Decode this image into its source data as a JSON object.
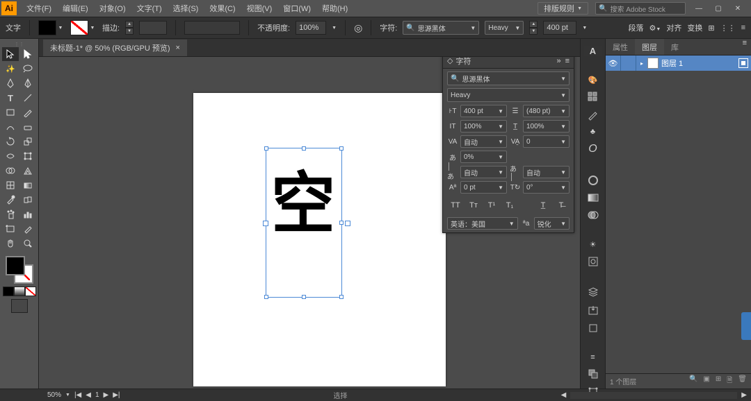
{
  "app_logo": "Ai",
  "menu": {
    "file": "文件(F)",
    "edit": "编辑(E)",
    "object": "对象(O)",
    "type": "文字(T)",
    "select": "选择(S)",
    "effect": "效果(C)",
    "view": "视图(V)",
    "window": "窗口(W)",
    "help": "帮助(H)"
  },
  "workspace": "排版规则",
  "stock_placeholder": "搜索 Adobe Stock",
  "control": {
    "mode_label": "文字",
    "stroke_label": "描边:",
    "stroke_val": "",
    "opacity_label": "不透明度:",
    "opacity_val": "100%",
    "char_label": "字符:",
    "font_family": "思源黑体",
    "font_style": "Heavy",
    "font_size": "400 pt",
    "right1": "段落",
    "right2": "对齐",
    "right3": "变换"
  },
  "tab": {
    "title": "未标题-1* @ 50% (RGB/GPU 预览)"
  },
  "glyph": "空",
  "char_panel": {
    "title": "字符",
    "font_family": "思源黑体",
    "font_style": "Heavy",
    "size": "400 pt",
    "leading": "(480 pt)",
    "vscale": "100%",
    "hscale": "100%",
    "kerning": "自动",
    "tracking": "0",
    "tsume": "0%",
    "aki_l": "自动",
    "aki_r": "自动",
    "baseline": "0 pt",
    "rotation": "0°",
    "language": "英语：美国",
    "aa": "锐化"
  },
  "layers_panel": {
    "tab_props": "属性",
    "tab_layers": "图层",
    "tab_lib": "库",
    "layer1": "图层 1",
    "footer": "1 个图层"
  },
  "status": {
    "zoom": "50%",
    "artboard_nav": "1",
    "tool": "选择"
  }
}
